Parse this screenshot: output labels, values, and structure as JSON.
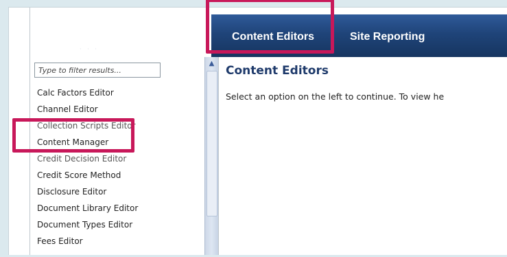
{
  "nav": {
    "tabs": [
      {
        "label": "Content Editors",
        "active": true
      },
      {
        "label": "Site Reporting",
        "active": false
      }
    ]
  },
  "sidebar": {
    "filter_placeholder": "Type to filter results...",
    "items": [
      {
        "label": "Calc Factors Editor"
      },
      {
        "label": "Channel Editor"
      },
      {
        "label": "Collection Scripts Editor"
      },
      {
        "label": "Content Manager"
      },
      {
        "label": "Credit Decision Editor"
      },
      {
        "label": "Credit Score Method"
      },
      {
        "label": "Disclosure Editor"
      },
      {
        "label": "Document Library Editor"
      },
      {
        "label": "Document Types Editor"
      },
      {
        "label": "Fees Editor"
      }
    ]
  },
  "main": {
    "title": "Content Editors",
    "description": "Select an option on the left to continue. To view he"
  },
  "colors": {
    "highlight": "#c8185a",
    "nav_bar": "#1f4479",
    "title": "#1e3a6b"
  }
}
